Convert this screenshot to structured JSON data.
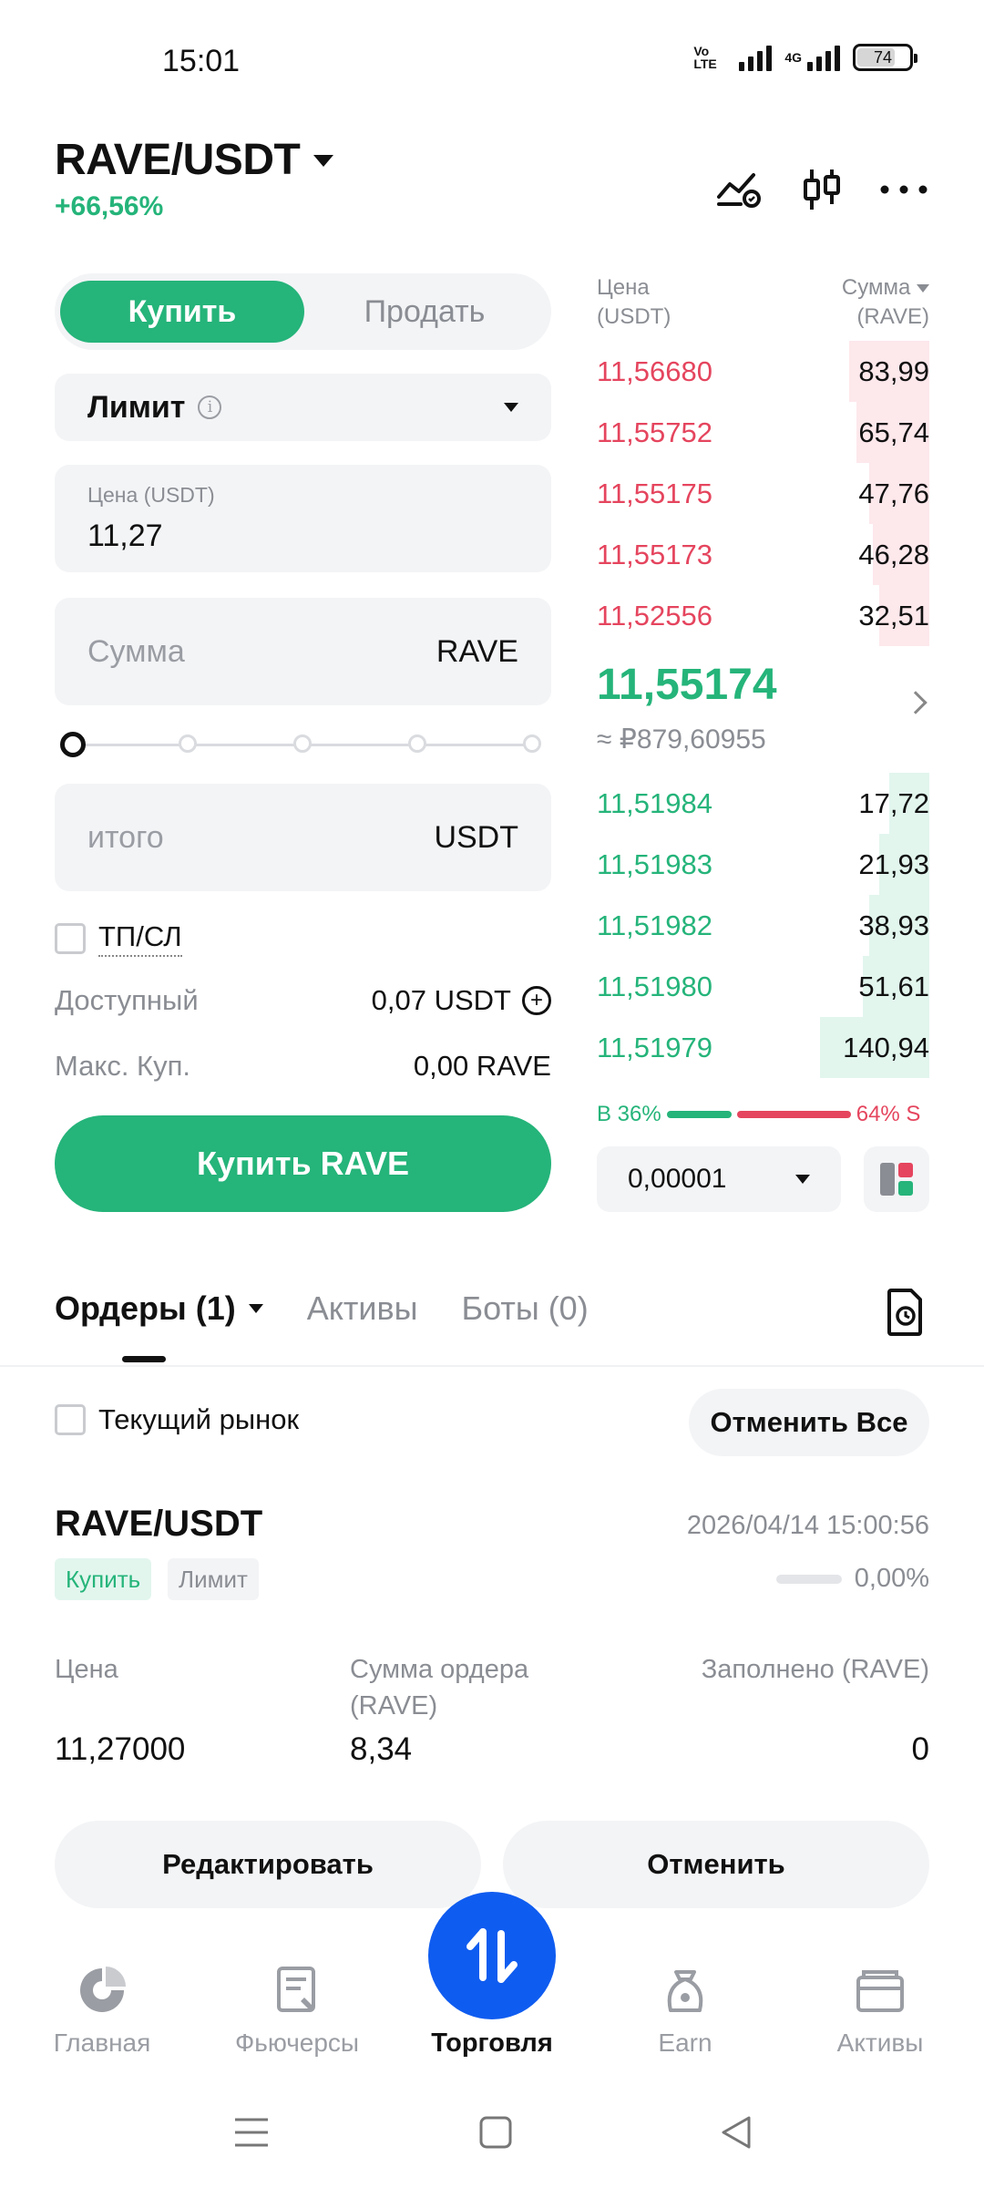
{
  "status_bar": {
    "time": "15:01",
    "volte": "Vo LTE",
    "network": "4G",
    "battery": "74",
    "battery_level": 0.74
  },
  "header": {
    "pair": "RAVE/USDT",
    "change": "+66,56%",
    "icons": [
      "chart-compare-icon",
      "candlestick-icon",
      "more-icon"
    ]
  },
  "trade_form": {
    "buy_label": "Купить",
    "sell_label": "Продать",
    "order_type": "Лимит",
    "price_caption": "Цена (USDT)",
    "price_value": "11,27",
    "amount_placeholder": "Сумма",
    "amount_unit": "RAVE",
    "total_placeholder": "итого",
    "total_unit": "USDT",
    "tpsl_label": "ТП/СЛ",
    "available_label": "Доступный",
    "available_value": "0,07 USDT",
    "max_buy_label": "Макс. Куп.",
    "max_buy_value": "0,00 RAVE",
    "submit_label": "Купить RAVE",
    "slider_value": 0
  },
  "order_book": {
    "price_header": "Цена\n(USDT)",
    "price_header_line1": "Цена",
    "price_header_line2": "(USDT)",
    "amount_header_line1": "Сумма",
    "amount_header_line2": "(RAVE)",
    "asks": [
      {
        "price": "11,56680",
        "amount": "83,99",
        "depth": 0.24
      },
      {
        "price": "11,55752",
        "amount": "65,74",
        "depth": 0.22
      },
      {
        "price": "11,55175",
        "amount": "47,76",
        "depth": 0.18
      },
      {
        "price": "11,55173",
        "amount": "46,28",
        "depth": 0.17
      },
      {
        "price": "11,52556",
        "amount": "32,51",
        "depth": 0.15
      }
    ],
    "mid_price": "11,55174",
    "mid_fiat": "≈ ₽879,60955",
    "bids": [
      {
        "price": "11,51984",
        "amount": "17,72",
        "depth": 0.12
      },
      {
        "price": "11,51983",
        "amount": "21,93",
        "depth": 0.15
      },
      {
        "price": "11,51982",
        "amount": "38,93",
        "depth": 0.18
      },
      {
        "price": "11,51980",
        "amount": "51,61",
        "depth": 0.2
      },
      {
        "price": "11,51979",
        "amount": "140,94",
        "depth": 0.33
      }
    ],
    "buy_ratio_label": "B 36%",
    "sell_ratio_label": "64% S",
    "buy_ratio": 0.36,
    "tick_size": "0,00001"
  },
  "orders_section": {
    "tabs": [
      "Ордеры (1)",
      "Активы",
      "Боты (0)"
    ],
    "current_market_label": "Текущий рынок",
    "cancel_all_label": "Отменить Все",
    "order": {
      "pair": "RAVE/USDT",
      "time": "2026/04/14 15:00:56",
      "side_tag": "Купить",
      "type_tag": "Лимит",
      "fill_percent": "0,00%",
      "fill_fraction": 0,
      "price_caption": "Цена",
      "amount_caption_line1": "Сумма ордера",
      "amount_caption_line2": "(RAVE)",
      "filled_caption": "Заполнено (RAVE)",
      "price_value": "11,27000",
      "amount_value": "8,34",
      "filled_value": "0",
      "edit_label": "Редактировать",
      "cancel_label": "Отменить"
    }
  },
  "bottom_nav": {
    "items": [
      "Главная",
      "Фьючерсы",
      "Торговля",
      "Earn",
      "Активы"
    ],
    "active": "Торговля"
  },
  "colors": {
    "green": "#25b47a",
    "red": "#e5455e",
    "fab_blue": "#0f5cf0"
  }
}
